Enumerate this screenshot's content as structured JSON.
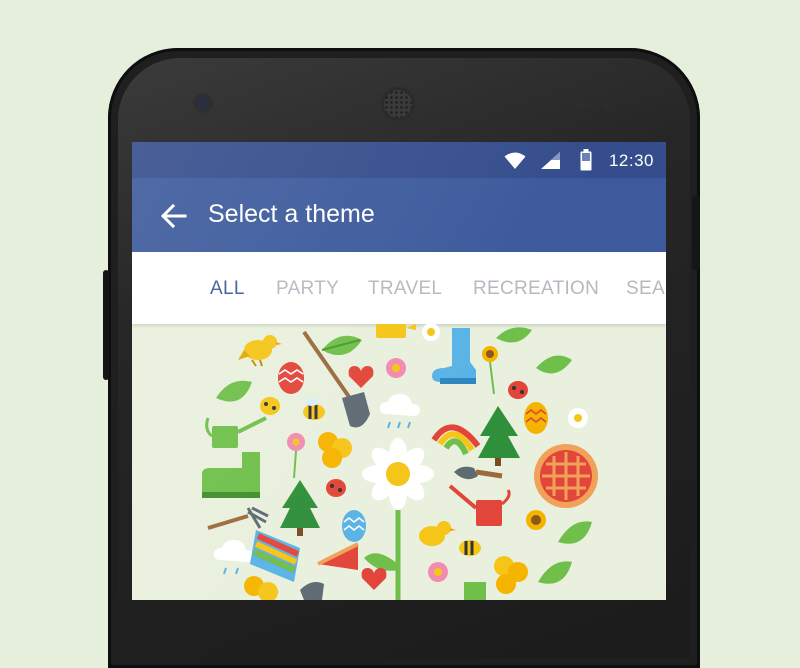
{
  "status_bar": {
    "time": "12:30",
    "icons": [
      "wifi-icon",
      "signal-icon",
      "battery-icon"
    ]
  },
  "app_bar": {
    "title": "Select a theme",
    "back_icon": "arrow-back-icon"
  },
  "tabs": [
    {
      "label": "ALL",
      "active": true
    },
    {
      "label": "PARTY",
      "active": false
    },
    {
      "label": "TRAVEL",
      "active": false
    },
    {
      "label": "RECREATION",
      "active": false
    },
    {
      "label": "SEA",
      "active": false
    }
  ],
  "theme_preview": {
    "name": "garden-spring-illustration",
    "icons": [
      "bird-icon",
      "leaf-icon",
      "watering-can-icon",
      "daisy-icon",
      "rubber-boot-icon",
      "sunflower-icon",
      "egg-icon",
      "shovel-icon",
      "heart-icon",
      "flower-icon",
      "ladybug-icon",
      "bee-icon",
      "cloud-icon",
      "rainbow-icon",
      "pine-tree-icon",
      "honeycomb-icon",
      "pie-icon",
      "rake-icon",
      "trowel-icon"
    ]
  },
  "colors": {
    "status_bar": "#354d8c",
    "app_bar": "#3c5a9c",
    "active_tab": "#3c5a9c",
    "inactive_tab": "#b5b9c0",
    "background": "#e6eedc"
  }
}
